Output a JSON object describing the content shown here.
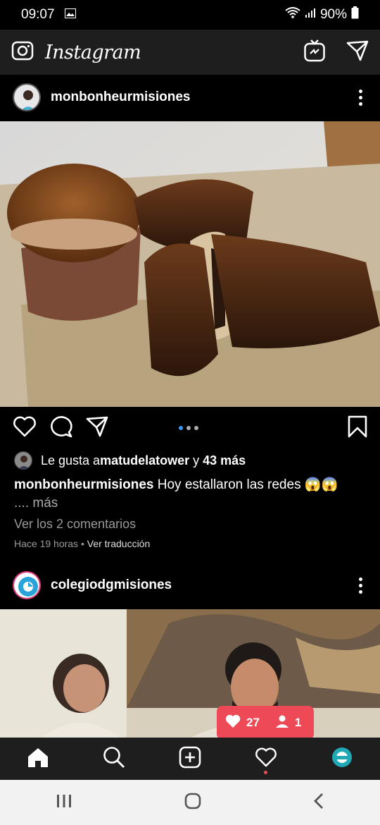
{
  "status": {
    "time": "09:07",
    "battery": "90%"
  },
  "app": {
    "logo": "Instagram"
  },
  "post1": {
    "username": "monbonheurmisiones",
    "likes_prefix": "Le gusta a ",
    "likes_user": "matudelatower",
    "likes_and": " y ",
    "likes_count": "43 más",
    "caption_user": "monbonheurmisiones",
    "caption_text": " Hoy estallaron las redes 😱😱",
    "caption_more": ".... más",
    "comments": "Ver los 2 comentarios",
    "time": "Hace 19 horas",
    "sep": " • ",
    "translate": "Ver traducción"
  },
  "post2": {
    "username": "colegiodgmisiones"
  },
  "notification": {
    "likes": "27",
    "followers": "1"
  },
  "colors": {
    "accent": "#3897f0",
    "notif": "#ed4956",
    "bar": "#1e1e1e"
  },
  "icons": [
    "camera-icon",
    "igtv-icon",
    "direct-icon",
    "heart-icon",
    "comment-icon",
    "share-icon",
    "bookmark-icon",
    "home-icon",
    "search-icon",
    "add-icon",
    "profile-icon"
  ]
}
